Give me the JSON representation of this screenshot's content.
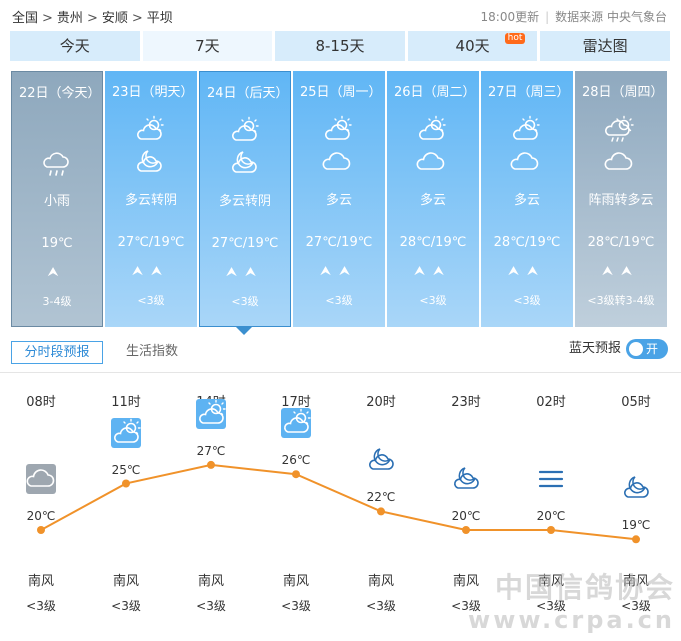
{
  "breadcrumb": [
    "全国",
    "贵州",
    "安顺",
    "平坝"
  ],
  "breadcrumb_sep": ">",
  "update_time": "18:00更新",
  "source_label": "数据来源 中央气象台",
  "tabs": [
    {
      "label": "今天",
      "active": false
    },
    {
      "label": "7天",
      "active": true
    },
    {
      "label": "8-15天",
      "active": false
    },
    {
      "label": "40天",
      "active": false,
      "badge": "hot"
    },
    {
      "label": "雷达图",
      "active": false
    }
  ],
  "days": [
    {
      "date": "22日（今天）",
      "icon_day": null,
      "icon_night": "rain-cloud-icon",
      "weather": "小雨",
      "temp": "19℃",
      "wind_arrows": 1,
      "wind": "3-4级"
    },
    {
      "date": "23日（明天）",
      "icon_day": "partly-cloudy-day-icon",
      "icon_night": "partly-cloudy-night-icon",
      "weather": "多云转阴",
      "temp": "27℃/19℃",
      "wind_arrows": 2,
      "wind": "<3级"
    },
    {
      "date": "24日（后天）",
      "icon_day": "partly-cloudy-day-icon",
      "icon_night": "partly-cloudy-night-icon",
      "weather": "多云转阴",
      "temp": "27℃/19℃",
      "wind_arrows": 2,
      "wind": "<3级"
    },
    {
      "date": "25日（周一）",
      "icon_day": "partly-cloudy-day-icon",
      "icon_night": "cloud-icon",
      "weather": "多云",
      "temp": "27℃/19℃",
      "wind_arrows": 2,
      "wind": "<3级"
    },
    {
      "date": "26日（周二）",
      "icon_day": "partly-cloudy-day-icon",
      "icon_night": "cloud-icon",
      "weather": "多云",
      "temp": "28℃/19℃",
      "wind_arrows": 2,
      "wind": "<3级"
    },
    {
      "date": "27日（周三）",
      "icon_day": "partly-cloudy-day-icon",
      "icon_night": "cloud-icon",
      "weather": "多云",
      "temp": "28℃/19℃",
      "wind_arrows": 2,
      "wind": "<3级"
    },
    {
      "date": "28日（周四）",
      "icon_day": "shower-cloud-icon",
      "icon_night": "cloud-icon",
      "weather": "阵雨转多云",
      "temp": "28℃/19℃",
      "wind_arrows": 2,
      "wind": "<3级转3-4级"
    }
  ],
  "subtabs": {
    "hourly": "分时段预报",
    "life": "生活指数"
  },
  "bluesky": {
    "label": "蓝天预报",
    "toggle": "开"
  },
  "hourly": {
    "times": [
      "08时",
      "11时",
      "14时",
      "17时",
      "20时",
      "23时",
      "02时",
      "05时"
    ],
    "temps": [
      20,
      25,
      27,
      26,
      22,
      20,
      20,
      19
    ],
    "temp_labels": [
      "20℃",
      "25℃",
      "27℃",
      "26℃",
      "22℃",
      "20℃",
      "20℃",
      "19℃"
    ],
    "icons": [
      "cloudy-icon",
      "partly-cloudy-day-icon",
      "partly-cloudy-day-icon",
      "partly-cloudy-day-icon",
      "moon-cloud-icon",
      "moon-cloud-icon",
      "haze-icon",
      "moon-cloud-icon"
    ],
    "wind_dir": [
      "南风",
      "南风",
      "南风",
      "南风",
      "南风",
      "南风",
      "南风",
      "南风"
    ],
    "wind_level": [
      "<3级",
      "<3级",
      "<3级",
      "<3级",
      "<3级",
      "<3级",
      "<3级",
      "<3级"
    ],
    "line_color": "#f0922a"
  },
  "watermark": {
    "line1": "中国信鸽协会",
    "line2": "www.crpa.cn"
  }
}
